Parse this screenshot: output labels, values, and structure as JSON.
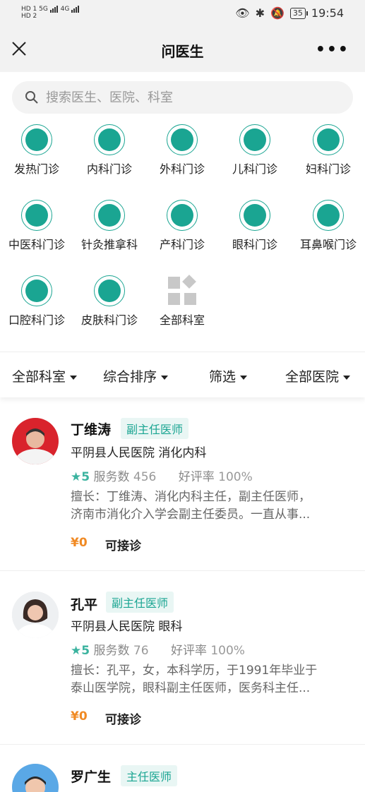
{
  "status_bar": {
    "hd1": "HD 1",
    "hd2": "HD 2",
    "net1": "5G",
    "net2": "4G",
    "battery": "35",
    "time": "19:54"
  },
  "nav": {
    "title": "问医生"
  },
  "search": {
    "placeholder": "搜索医生、医院、科室"
  },
  "departments": [
    "发热门诊",
    "内科门诊",
    "外科门诊",
    "儿科门诊",
    "妇科门诊",
    "中医科门诊",
    "针灸推拿科",
    "产科门诊",
    "眼科门诊",
    "耳鼻喉门诊",
    "口腔科门诊",
    "皮肤科门诊",
    "全部科室"
  ],
  "filters": [
    "全部科室",
    "综合排序",
    "筛选",
    "全部医院"
  ],
  "doctors": [
    {
      "name": "丁维涛",
      "title": "副主任医师",
      "hospital": "平阴县人民医院 消化内科",
      "rating": "5",
      "service_label": "服务数",
      "service_count": "456",
      "praise_label": "好评率",
      "praise_rate": "100%",
      "desc_line1": "擅长：丁维涛、消化内科主任，副主任医师，",
      "desc_line2": "济南市消化介入学会副主任委员。一直从事...",
      "price": "¥0",
      "availability": "可接诊"
    },
    {
      "name": "孔平",
      "title": "副主任医师",
      "hospital": "平阴县人民医院 眼科",
      "rating": "5",
      "service_label": "服务数",
      "service_count": "76",
      "praise_label": "好评率",
      "praise_rate": "100%",
      "desc_line1": "擅长：孔平，女，本科学历，于1991年毕业于",
      "desc_line2": "泰山医学院，眼科副主任医师，医务科主任...",
      "price": "¥0",
      "availability": "可接诊"
    },
    {
      "name": "罗广生",
      "title": "主任医师"
    }
  ],
  "colors": {
    "accent": "#1aa592",
    "price": "#f08a24",
    "nav_bg": "#f2f2f2"
  }
}
